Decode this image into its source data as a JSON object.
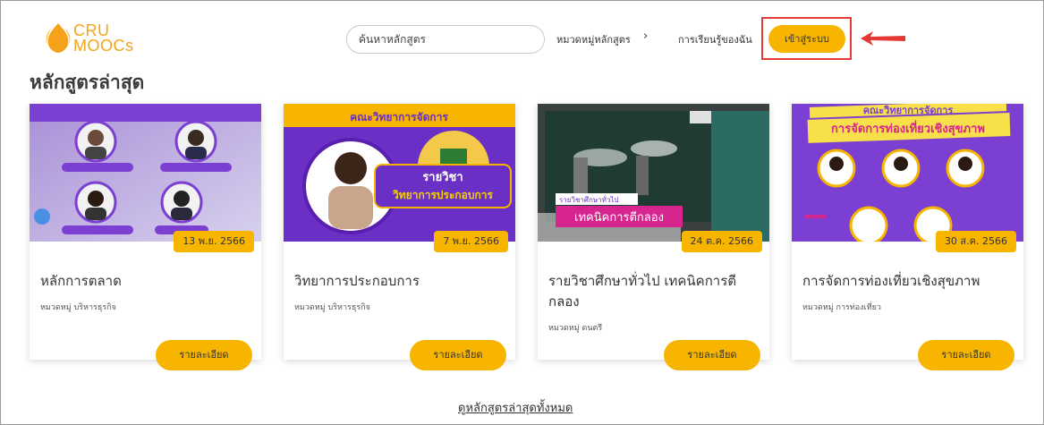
{
  "header": {
    "logo_line1": "CRU",
    "logo_line2": "MOOCs",
    "search_placeholder": "ค้นหาหลักสูตร",
    "nav_categories": "หมวดหมู่หลักสูตร",
    "nav_chevron": "›",
    "nav_my_learning": "การเรียนรู้ของฉัน",
    "login_label": "เข้าสู่ระบบ",
    "highlight_color": "#e53935"
  },
  "section": {
    "title": "หลักสูตรล่าสุด"
  },
  "cards": [
    {
      "title": "หลักการตลาด",
      "category": "หมวดหมู่ บริหารธุรกิจ",
      "date": "13 พ.ย. 2566",
      "button": "รายละเอียด"
    },
    {
      "title": "วิทยาการประกอบการ",
      "category": "หมวดหมู่ บริหารธุรกิจ",
      "date": "7 พ.ย. 2566",
      "button": "รายละเอียด",
      "banner_faculty": "คณะวิทยาการจัดการ",
      "banner_line1": "รายวิชา",
      "banner_line2": "วิทยาการประกอบการ"
    },
    {
      "title": "รายวิชาศึกษาทั่วไป เทคนิคการตีกลอง",
      "category": "หมวดหมู่ ดนตรี",
      "date": "24 ต.ค. 2566",
      "button": "รายละเอียด",
      "banner_small": "รายวิชาศึกษาทั่วไป",
      "banner_big": "เทคนิคการตีกลอง"
    },
    {
      "title": "การจัดการท่องเที่ยวเชิงสุขภาพ",
      "category": "หมวดหมู่ การท่องเที่ยว",
      "date": "30 ส.ค. 2566",
      "button": "รายละเอียด",
      "banner_faculty": "คณะวิทยาการจัดการ",
      "banner_title": "การจัดการท่องเที่ยวเชิงสุขภาพ"
    }
  ],
  "footer": {
    "view_all": "ดูหลักสูตรล่าสุดทั้งหมด"
  },
  "colors": {
    "accent": "#f7b500",
    "arrow": "#e53935",
    "purple": "#7b3fd1"
  }
}
